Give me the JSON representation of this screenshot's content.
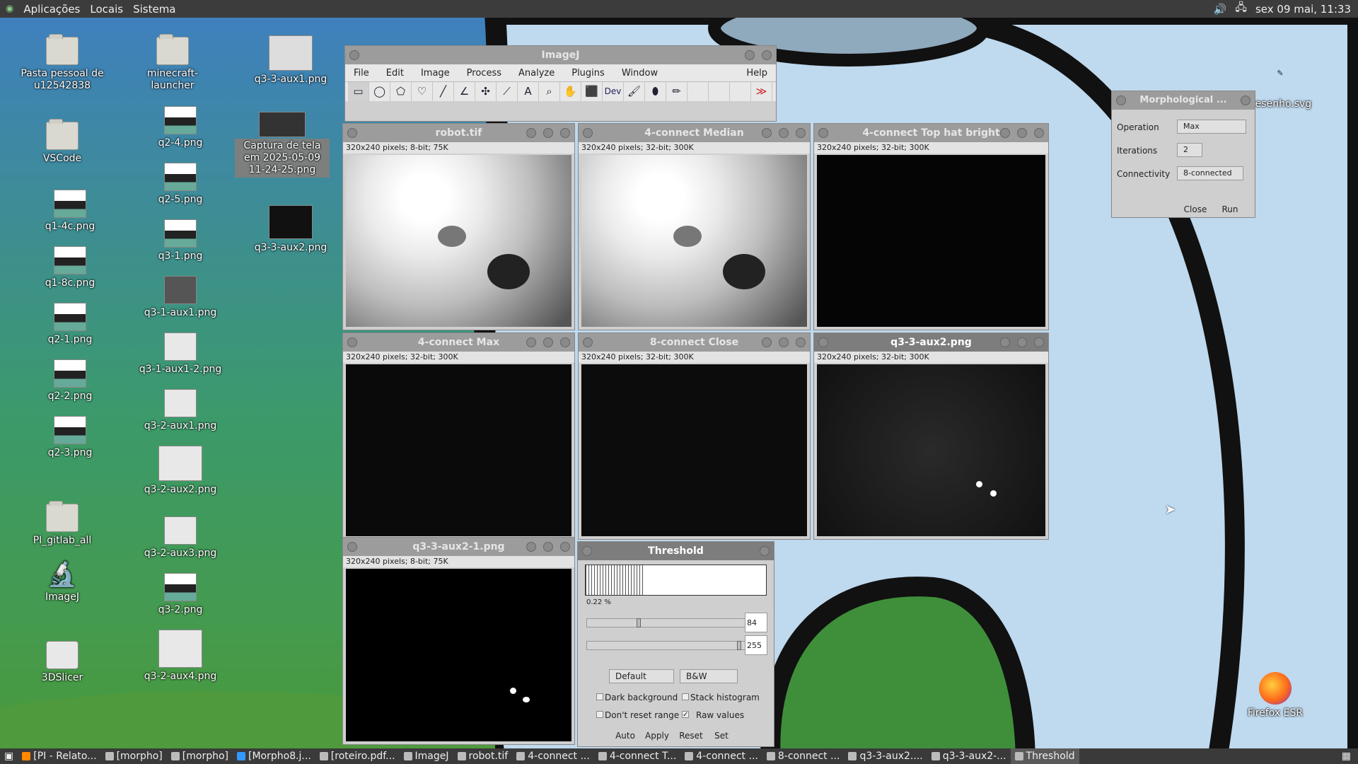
{
  "top_panel": {
    "menu": [
      "Aplicações",
      "Locais",
      "Sistema"
    ],
    "datetime": "sex 09 mai, 11:33"
  },
  "desktop_icons": [
    {
      "label": "Pasta pessoal de u12542838",
      "icon": "home-folder-icon"
    },
    {
      "label": "VSCode",
      "icon": "folder-icon"
    },
    {
      "label": "q1-4c.png",
      "icon": "image-file-icon"
    },
    {
      "label": "q1-8c.png",
      "icon": "image-file-icon"
    },
    {
      "label": "q2-1.png",
      "icon": "image-file-icon"
    },
    {
      "label": "q2-2.png",
      "icon": "image-file-icon"
    },
    {
      "label": "q2-3.png",
      "icon": "image-file-icon"
    },
    {
      "label": "PI_gitlab_all",
      "icon": "folder-icon"
    },
    {
      "label": "ImageJ",
      "icon": "microscope-icon"
    },
    {
      "label": "3DSlicer",
      "icon": "slicer-icon"
    },
    {
      "label": "minecraft-launcher",
      "icon": "folder-icon"
    },
    {
      "label": "q2-4.png",
      "icon": "image-file-icon"
    },
    {
      "label": "q2-5.png",
      "icon": "image-file-icon"
    },
    {
      "label": "q3-1.png",
      "icon": "image-file-icon"
    },
    {
      "label": "q3-1-aux1.png",
      "icon": "image-file-icon"
    },
    {
      "label": "q3-1-aux1-2.png",
      "icon": "image-file-icon"
    },
    {
      "label": "q3-2-aux1.png",
      "icon": "image-file-icon"
    },
    {
      "label": "q3-2-aux2.png",
      "icon": "image-file-icon"
    },
    {
      "label": "q3-2-aux3.png",
      "icon": "image-file-icon"
    },
    {
      "label": "q3-2.png",
      "icon": "image-file-icon"
    },
    {
      "label": "q3-2-aux4.png",
      "icon": "image-file-icon"
    },
    {
      "label": "q3-3-aux1.png",
      "icon": "image-file-icon"
    },
    {
      "label": "Captura de tela em 2025-05-09 11-24-25.png",
      "icon": "screenshot-file-icon"
    },
    {
      "label": "q3-3-aux2.png",
      "icon": "image-file-icon"
    },
    {
      "label": "desenho.svg",
      "icon": "svg-file-icon"
    },
    {
      "label": "Firefox ESR",
      "icon": "firefox-icon"
    }
  ],
  "imagej": {
    "title": "ImageJ",
    "menu": [
      "File",
      "Edit",
      "Image",
      "Process",
      "Analyze",
      "Plugins",
      "Window",
      "Help"
    ],
    "tools": [
      "rectangle-tool-icon",
      "oval-tool-icon",
      "polygon-tool-icon",
      "freehand-tool-icon",
      "line-tool-icon",
      "angle-tool-icon",
      "point-tool-icon",
      "wand-tool-icon",
      "text-tool-icon",
      "magnifier-tool-icon",
      "hand-tool-icon",
      "color-picker-tool-icon",
      "dev-tool-icon",
      "brush-tool-icon",
      "flood-fill-tool-icon",
      "pencil-tool-icon",
      "more-tools-icon"
    ],
    "dev_label": "Dev",
    "more_label": "≫"
  },
  "image_windows": [
    {
      "title": "robot.tif",
      "info": "320x240 pixels; 8-bit; 75K"
    },
    {
      "title": "4-connect Median",
      "info": "320x240 pixels; 32-bit; 300K"
    },
    {
      "title": "4-connect Top hat bright",
      "info": "320x240 pixels; 32-bit; 300K"
    },
    {
      "title": "4-connect Max",
      "info": "320x240 pixels; 32-bit; 300K"
    },
    {
      "title": "8-connect Close",
      "info": "320x240 pixels; 32-bit; 300K"
    },
    {
      "title": "q3-3-aux2.png",
      "info": "320x240 pixels; 32-bit; 300K"
    },
    {
      "title": "q3-3-aux2-1.png",
      "info": "320x240 pixels; 8-bit; 75K"
    }
  ],
  "threshold": {
    "title": "Threshold",
    "percent": "0.22 %",
    "min_value": "84",
    "max_value": "255",
    "min_level": 0.33,
    "max_level": 1.0,
    "method": "Default",
    "display": "B&W",
    "dark_background": "Dark background",
    "stack_histogram": "Stack histogram",
    "dont_reset_range": "Don't reset range",
    "raw_values": "Raw values",
    "buttons": [
      "Auto",
      "Apply",
      "Reset",
      "Set"
    ]
  },
  "morphological": {
    "title": "Morphological ...",
    "operation_label": "Operation",
    "operation_value": "Max",
    "iterations_label": "Iterations",
    "iterations_value": "2",
    "connectivity_label": "Connectivity",
    "connectivity_value": "8-connected",
    "close_label": "Close",
    "run_label": "Run"
  },
  "taskbar": [
    {
      "label": "[PI - Relato...",
      "icon": "firefox-icon"
    },
    {
      "label": "[morpho]",
      "icon": "folder-icon"
    },
    {
      "label": "[morpho]",
      "icon": "folder-icon"
    },
    {
      "label": "[Morpho8.j...",
      "icon": "vscode-icon"
    },
    {
      "label": "[roteiro.pdf...",
      "icon": "pdf-icon"
    },
    {
      "label": "ImageJ",
      "icon": "imagej-icon"
    },
    {
      "label": "robot.tif",
      "icon": "imagej-icon"
    },
    {
      "label": "4-connect ...",
      "icon": "imagej-icon"
    },
    {
      "label": "4-connect T...",
      "icon": "imagej-icon"
    },
    {
      "label": "4-connect ...",
      "icon": "imagej-icon"
    },
    {
      "label": "8-connect ...",
      "icon": "imagej-icon"
    },
    {
      "label": "q3-3-aux2....",
      "icon": "imagej-icon"
    },
    {
      "label": "q3-3-aux2-...",
      "icon": "imagej-icon"
    },
    {
      "label": "Threshold",
      "icon": "imagej-icon"
    }
  ]
}
